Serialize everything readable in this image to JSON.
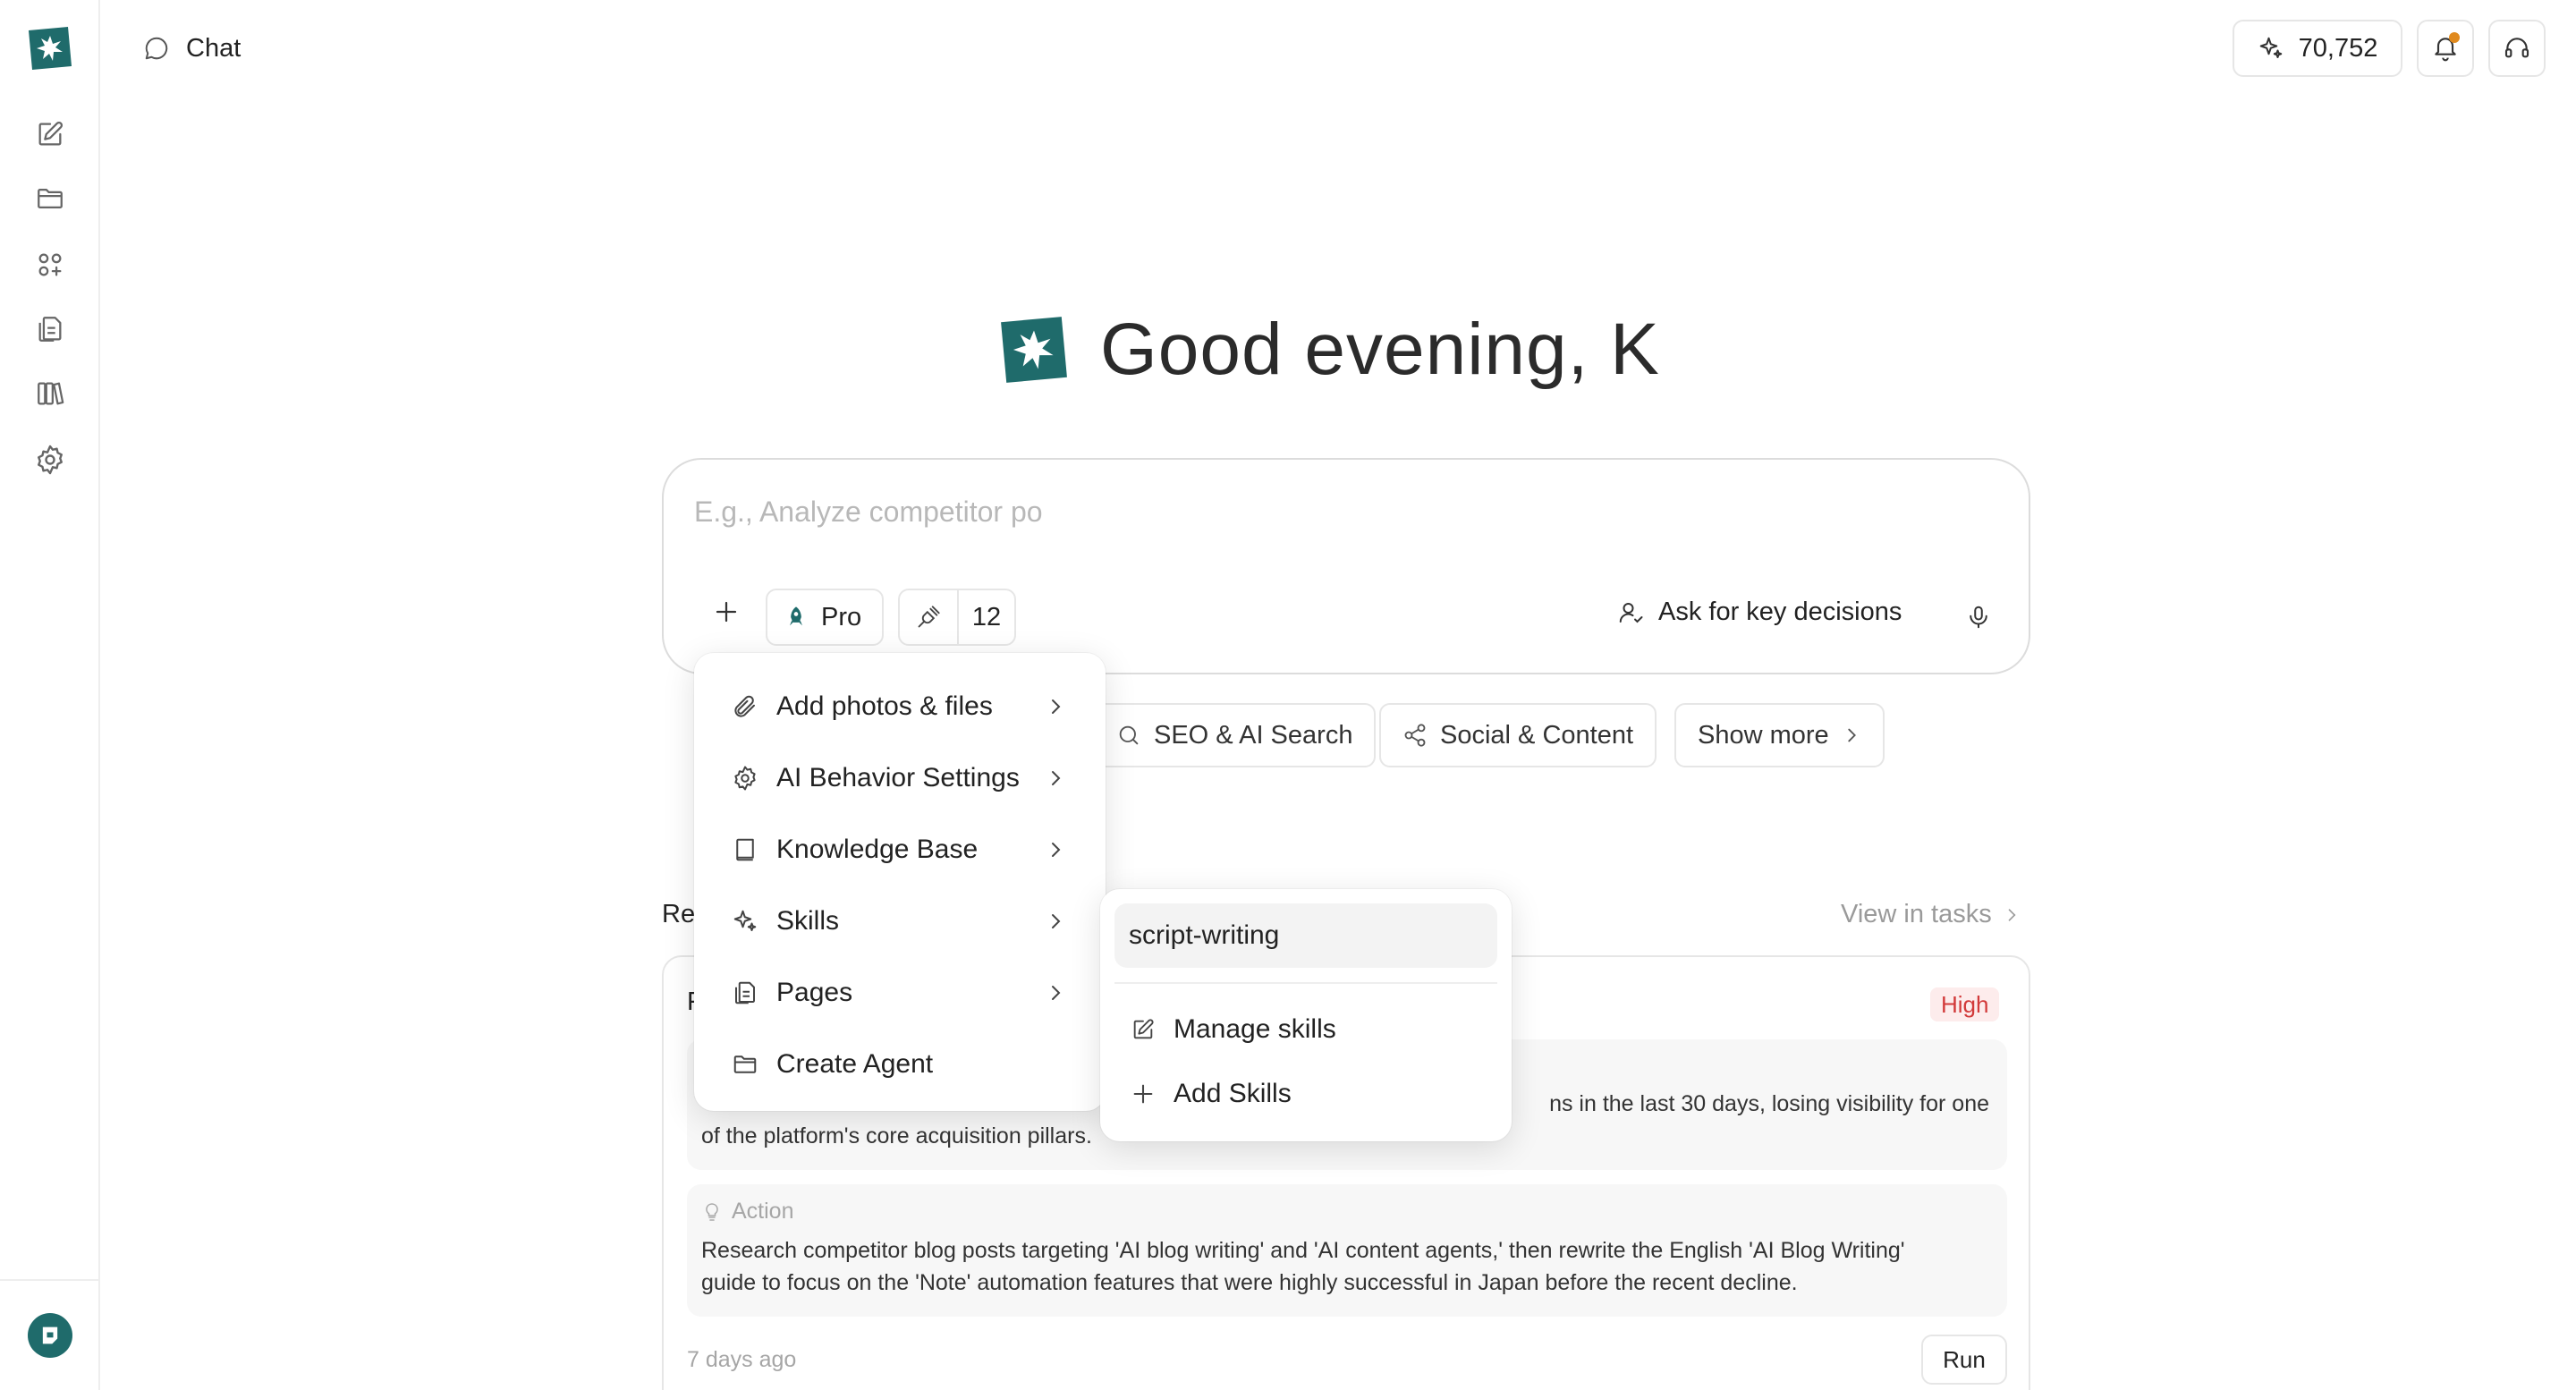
{
  "header": {
    "title": "Chat",
    "credits": "70,752"
  },
  "greeting": "Good evening, K",
  "composer": {
    "placeholder": "E.g., Analyze competitor po",
    "mode_label": "Pro",
    "tools_count": "12",
    "ask_label": "Ask for key decisions"
  },
  "categories": [
    {
      "label": "SEO & AI Search"
    },
    {
      "label": "Social & Content"
    },
    {
      "label": "Show more"
    }
  ],
  "recent": {
    "title_partial": "Re",
    "view_link": "View in tasks",
    "task": {
      "title_partial": "F",
      "priority": "High",
      "summary_visible_end": "ns in the last 30 days, losing visibility for one",
      "summary_line2": "of the platform's core acquisition pillars.",
      "action_label": "Action",
      "action_line1": "Research competitor blog posts targeting 'AI blog writing' and 'AI content agents,' then rewrite the English 'AI Blog Writing'",
      "action_line2": "guide to focus on the 'Note' automation features that were highly successful in Japan before the recent decline.",
      "age": "7 days ago",
      "run_label": "Run"
    }
  },
  "plus_menu": {
    "items": [
      {
        "label": "Add photos & files",
        "icon": "paperclip-icon"
      },
      {
        "label": "AI Behavior Settings",
        "icon": "gear-icon"
      },
      {
        "label": "Knowledge Base",
        "icon": "book-icon"
      },
      {
        "label": "Skills",
        "icon": "sparkle-icon"
      },
      {
        "label": "Pages",
        "icon": "pages-icon"
      },
      {
        "label": "Create Agent",
        "icon": "folder-icon"
      }
    ]
  },
  "skills_menu": {
    "selected": "script-writing",
    "manage_label": "Manage skills",
    "add_label": "Add Skills"
  },
  "colors": {
    "brand": "#1f6b6b",
    "high_badge": "#d23a3a",
    "notification": "#e08a1e"
  }
}
